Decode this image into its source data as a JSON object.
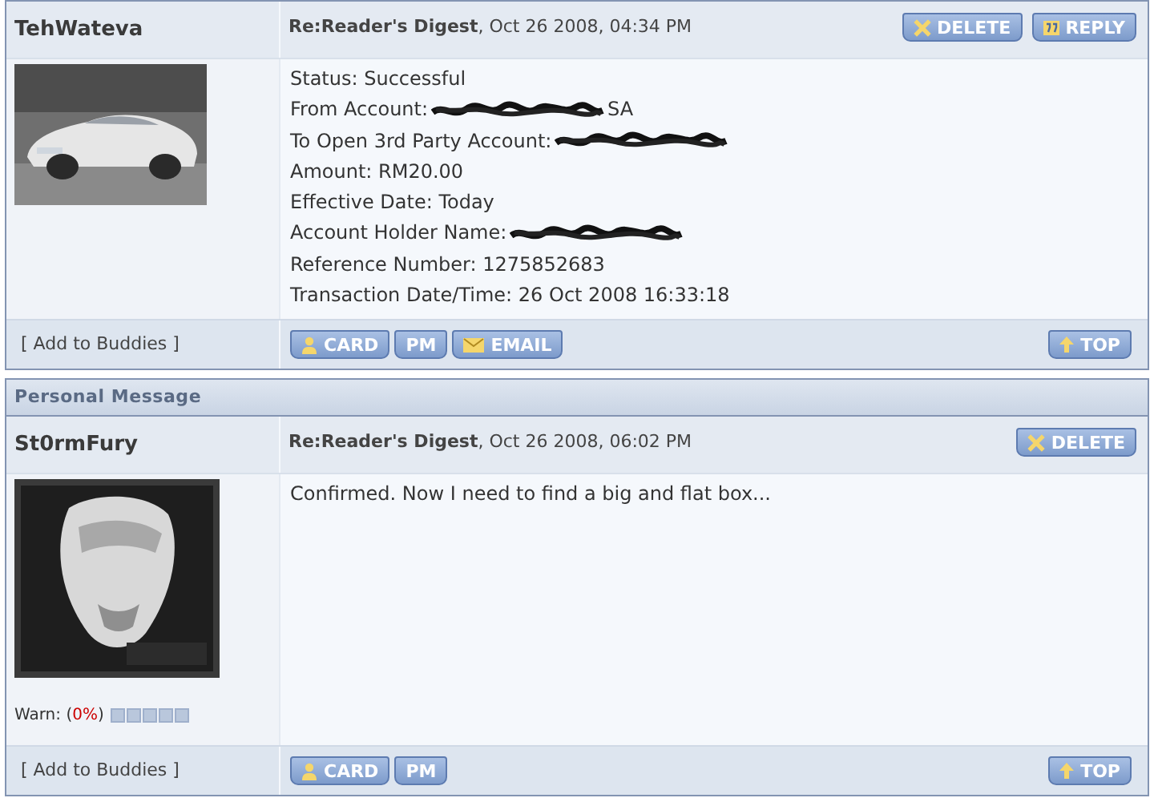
{
  "posts": [
    {
      "author": "TehWateva",
      "subject": "Re:Reader's Digest",
      "date": ", Oct 26 2008, 04:34 PM",
      "avatar": {
        "kind": "picture"
      },
      "actions": [
        {
          "kind": "delete",
          "label": "DELETE"
        },
        {
          "kind": "reply",
          "label": "REPLY"
        }
      ],
      "lines": [
        {
          "text": "Status: Successful",
          "redacted": false
        },
        {
          "text": "From Account:",
          "redacted": true,
          "after": "SA"
        },
        {
          "text": "To Open 3rd Party Account:",
          "redacted": true
        },
        {
          "text": "Amount: RM20.00",
          "redacted": false
        },
        {
          "text": "Effective Date: Today",
          "redacted": false
        },
        {
          "text": "Account Holder Name:",
          "redacted": true
        },
        {
          "text": "Reference Number: 1275852683",
          "redacted": false
        },
        {
          "text": "Transaction Date/Time: 26 Oct 2008 16:33:18",
          "redacted": false
        }
      ],
      "buddies": "[ Add to Buddies ]",
      "footer_buttons": [
        {
          "kind": "card",
          "label": "CARD"
        },
        {
          "kind": "pm",
          "label": "PM"
        },
        {
          "kind": "email",
          "label": "EMAIL"
        }
      ],
      "top": "TOP"
    },
    {
      "section_title": "Personal Message",
      "author": "St0rmFury",
      "subject": "Re:Reader's Digest",
      "date": ", Oct 26 2008, 06:02 PM",
      "avatar": {
        "kind": "picture"
      },
      "actions": [
        {
          "kind": "delete",
          "label": "DELETE"
        }
      ],
      "lines": [
        {
          "text": "Confirmed. Now I need to find a big and flat box...",
          "redacted": false
        }
      ],
      "warn": {
        "prefix": "Warn: (",
        "value": "0%",
        "suffix": ")"
      },
      "buddies": "[ Add to Buddies ]",
      "footer_buttons": [
        {
          "kind": "card",
          "label": "CARD"
        },
        {
          "kind": "pm",
          "label": "PM"
        }
      ],
      "top": "TOP"
    }
  ]
}
